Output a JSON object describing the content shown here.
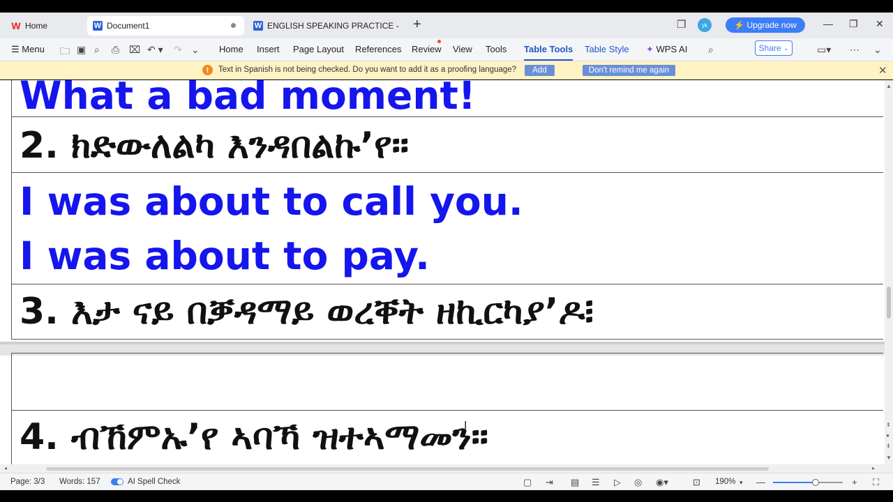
{
  "tabs": {
    "home": "Home",
    "doc1": "Document1",
    "doc2": "ENGLISH SPEAKING PRACTICE - DIALO"
  },
  "account": {
    "avatar_text": "yk",
    "upgrade": "Upgrade now"
  },
  "menu": {
    "menu": "Menu",
    "items": [
      "Home",
      "Insert",
      "Page Layout",
      "References",
      "Review",
      "View",
      "Tools"
    ],
    "table_tools": "Table Tools",
    "table_style": "Table Style",
    "wps_ai": "WPS AI",
    "share": "Share"
  },
  "notification": {
    "text": "Text in Spanish is not being checked. Do you want to add it as a proofing language?",
    "add": "Add",
    "dont_remind": "Don't remind me again"
  },
  "document": {
    "line1": "What a bad moment!",
    "line2": "2. ክድውለልካ እንዳበልኩ’የ።",
    "line3": "I was about to call you.",
    "line4": "I was about to pay.",
    "line5": "3. እታ ናይ በቓዳማይ ወረቐት ዘኪርካያ’ዶ፧",
    "line6": "4. ብኸምኡ’የ ኣባኻ ዝተኣማመን።"
  },
  "status": {
    "page": "Page: 3/3",
    "words": "Words: 157",
    "spell": "AI Spell Check",
    "zoom": "190%",
    "zoom_level": 0.6
  },
  "colors": {
    "accent": "#3d7df5",
    "english_text": "#1515ee",
    "notice_bg": "#fff2c5"
  }
}
